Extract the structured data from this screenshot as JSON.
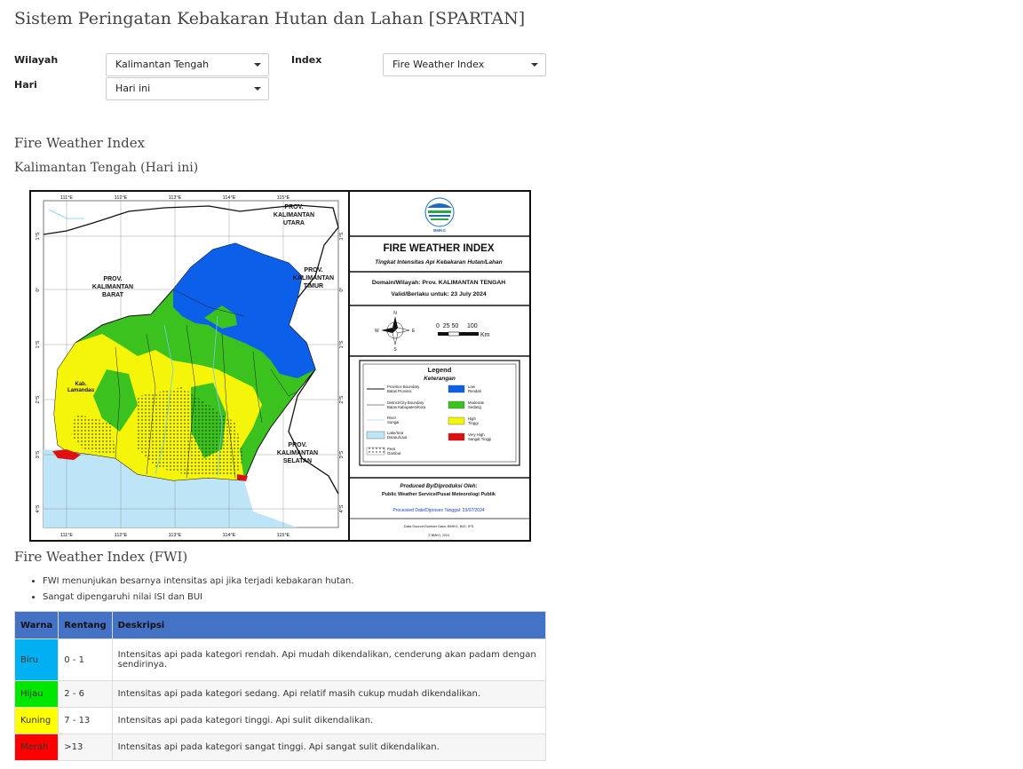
{
  "app": {
    "title": "Sistem Peringatan Kebakaran Hutan dan Lahan [SPARTAN]"
  },
  "filters": {
    "wilayah_label": "Wilayah",
    "wilayah_value": "Kalimantan Tengah",
    "hari_label": "Hari",
    "hari_value": "Hari ini",
    "index_label": "Index",
    "index_value": "Fire Weather Index"
  },
  "section": {
    "index_title": "Fire Weather Index",
    "region_title": "Kalimantan Tengah (Hari ini)"
  },
  "map": {
    "lon_ticks": [
      "111°E",
      "112°E",
      "113°E",
      "114°E",
      "115°E"
    ],
    "lat_ticks": [
      "1°S",
      "0°",
      "1°S",
      "2°S",
      "3°S",
      "4°S"
    ],
    "region_labels": {
      "kaltara": "PROV.\nKALIMANTAN\nUTARA",
      "kalbar": "PROV.\nKALIMANTAN\nBARAT",
      "kaltim": "PROV.\nKALIMANTAN\nTIMUR",
      "kalsel": "PROV.\nKALIMANTAN\nSELATAN",
      "kab_lamandau": "Kab.\nLamandau"
    },
    "panel": {
      "logo_text": "BMKG",
      "title": "FIRE WEATHER INDEX",
      "subtitle": "Tingkat Intensitas Api Kebakaran Hutan/Lahan",
      "domain": "Domain/Wilayah: Prov. KALIMANTAN TENGAH",
      "valid": "Valid/Berlaku untuk: 23 July 2024",
      "scale_label": "0  25 50     100",
      "scale_unit": "Km",
      "compass": {
        "n": "N",
        "e": "E",
        "s": "S",
        "w": "W"
      },
      "legend_title": "Legend",
      "legend_subtitle": "Keterangan",
      "legend_lines": [
        "Province Boundary\nBatas Provinsi",
        "District/City Boundary\nBatas Kabupaten/Kota",
        "River\nSungai",
        "Lake/Sea\nDanau/Laut",
        "Peat\nGambut"
      ],
      "legend_classes": [
        {
          "label": "Low\nRendah",
          "color": "#0b5fe8"
        },
        {
          "label": "Moderate\nSedang",
          "color": "#3cc21e"
        },
        {
          "label": "High\nTinggi",
          "color": "#f5f50a"
        },
        {
          "label": "Very High\nSangat Tinggi",
          "color": "#e01010"
        }
      ],
      "produced_by": "Produced By/Diproduksi Oleh:",
      "producer": "Public Weather Service/Pusat Meteorologi Publik",
      "processed": "Processed Date/Diproses Tanggal: 23/07/2024",
      "source": "Data Source/Sumber Data: BMKG, BIG, IFS",
      "copyright": "© BMKG, 2024"
    }
  },
  "fwi_section": {
    "title": "Fire Weather Index (FWI)",
    "notes": [
      "FWI menunjukan besarnya intensitas api jika terjadi kebakaran hutan.",
      "Sangat dipengaruhi nilai ISI dan BUI"
    ]
  },
  "table": {
    "headers": [
      "Warna",
      "Rentang",
      "Deskripsi"
    ],
    "rows": [
      {
        "warna": "Biru",
        "color": "#00b0f0",
        "rentang": "0 - 1",
        "deskripsi": "Intensitas api pada kategori rendah. Api mudah dikendalikan, cenderung akan padam dengan sendirinya."
      },
      {
        "warna": "Hijau",
        "color": "#00e600",
        "rentang": "2 - 6",
        "deskripsi": "Intensitas api pada kategori sedang. Api relatif masih cukup mudah dikendalikan."
      },
      {
        "warna": "Kuning",
        "color": "#ffff00",
        "rentang": "7 - 13",
        "deskripsi": "Intensitas api pada kategori tinggi. Api sulit dikendalikan."
      },
      {
        "warna": "Merah",
        "color": "#ff0000",
        "rentang": ">13",
        "deskripsi": "Intensitas api pada kategori sangat tinggi. Api sangat sulit dikendalikan."
      }
    ]
  }
}
